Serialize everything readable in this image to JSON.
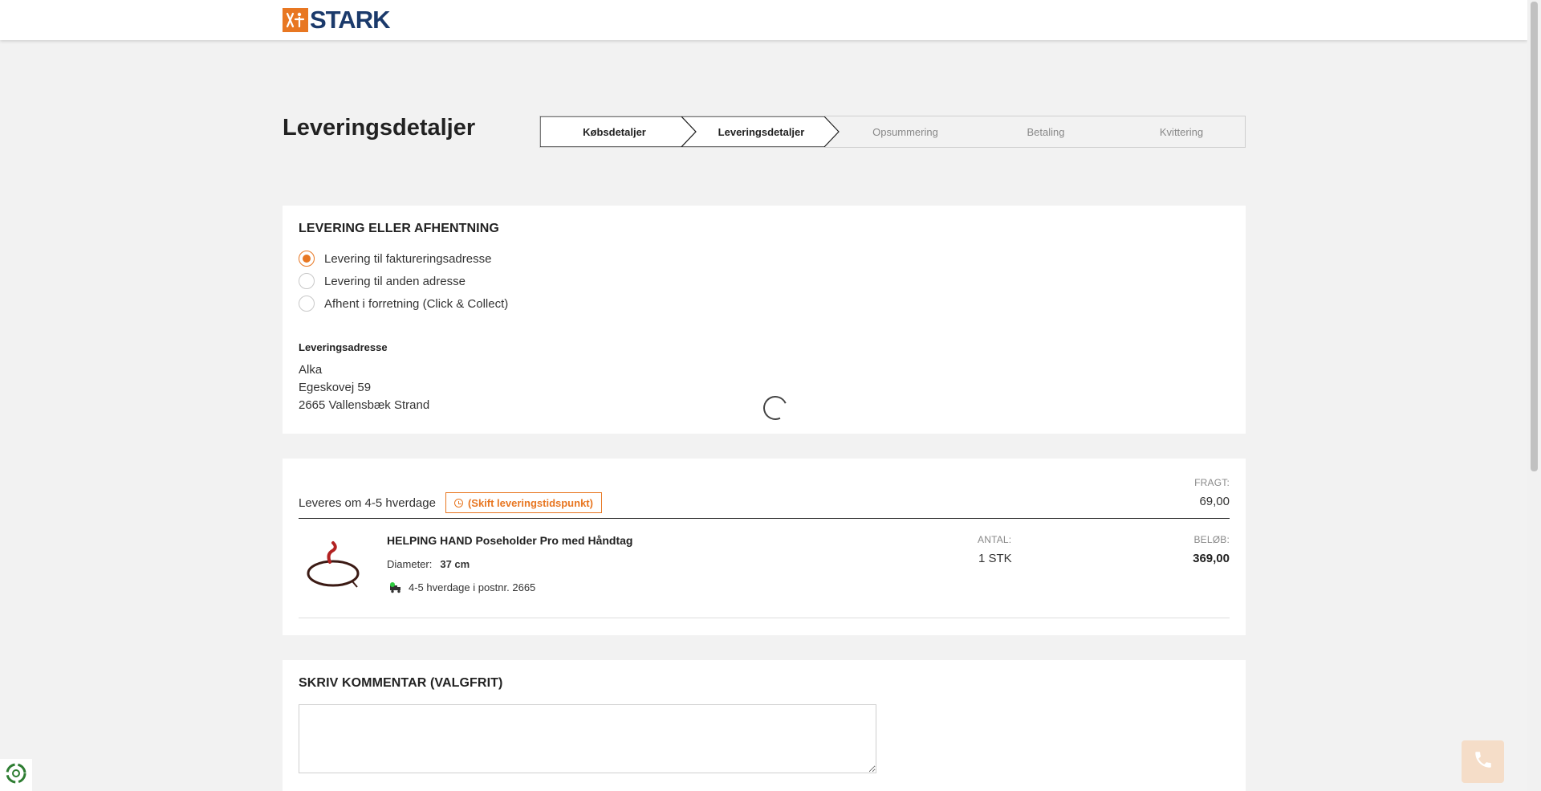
{
  "brand": {
    "name": "STARK",
    "accent": "#e87722",
    "navy": "#1b3a6b"
  },
  "page": {
    "title": "Leveringsdetaljer"
  },
  "steps": [
    {
      "label": "Købsdetaljer",
      "state": "done"
    },
    {
      "label": "Leveringsdetaljer",
      "state": "active"
    },
    {
      "label": "Opsummering",
      "state": "upcoming"
    },
    {
      "label": "Betaling",
      "state": "upcoming"
    },
    {
      "label": "Kvittering",
      "state": "upcoming"
    }
  ],
  "delivery": {
    "title": "LEVERING ELLER AFHENTNING",
    "options": [
      {
        "label": "Levering til faktureringsadresse",
        "selected": true
      },
      {
        "label": "Levering til anden adresse",
        "selected": false
      },
      {
        "label": "Afhent i forretning (Click & Collect)",
        "selected": false
      }
    ],
    "address_title": "Leveringsadresse",
    "address_lines": [
      "Alka",
      "Egeskovej 59",
      "2665 Vallensbæk Strand"
    ]
  },
  "shipment": {
    "eta": "Leveres om 4-5 hverdage",
    "change_label": "(Skift leveringstidspunkt)",
    "freight_label": "FRAGT:",
    "freight_value": "69,00",
    "product": {
      "name": "HELPING HAND Poseholder Pro med Håndtag",
      "attr_label": "Diameter:",
      "attr_value": "37 cm",
      "stock_text": "4-5 hverdage i postnr. 2665",
      "qty_label": "ANTAL:",
      "qty_value": "1 STK",
      "amount_label": "BELØB:",
      "amount_value": "369,00"
    }
  },
  "comment": {
    "title": "SKRIV KOMMENTAR (VALGFRIT)",
    "value": "",
    "placeholder": ""
  },
  "icons": {
    "phone": "phone-icon",
    "cookie": "cookie-settings-icon",
    "truck": "truck-icon",
    "clock": "clock-icon"
  }
}
